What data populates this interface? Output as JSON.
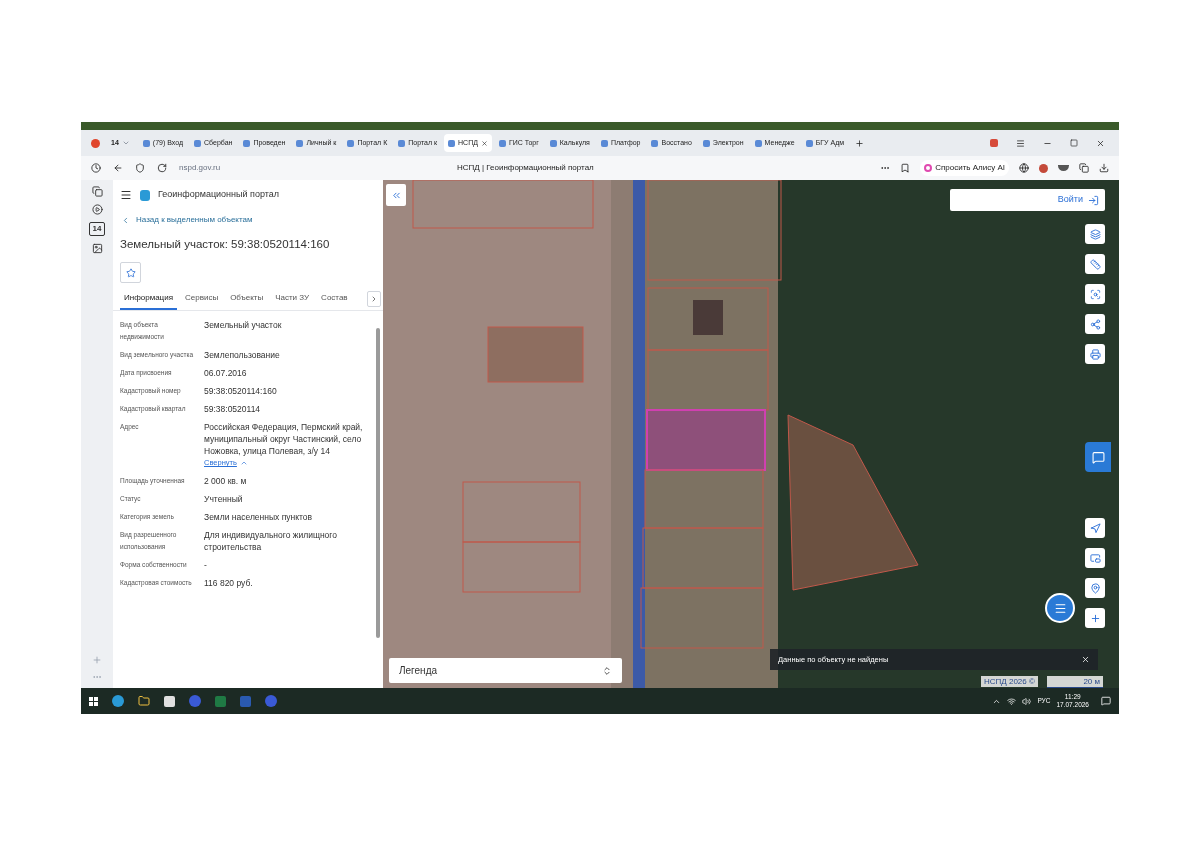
{
  "browser": {
    "tab_counter": "14",
    "tabs": [
      {
        "label": "(79) Вход",
        "selected": false
      },
      {
        "label": "Сбербан",
        "selected": false
      },
      {
        "label": "Проведен",
        "selected": false
      },
      {
        "label": "Личный к",
        "selected": false
      },
      {
        "label": "Портал К",
        "selected": false
      },
      {
        "label": "Портал к",
        "selected": false
      },
      {
        "label": "НСПД",
        "selected": true
      },
      {
        "label": "ГИС Торг",
        "selected": false
      },
      {
        "label": "Калькуля",
        "selected": false
      },
      {
        "label": "Платфор",
        "selected": false
      },
      {
        "label": "Восстано",
        "selected": false
      },
      {
        "label": "Электрон",
        "selected": false
      },
      {
        "label": "Менедже",
        "selected": false
      },
      {
        "label": "БГУ Адм",
        "selected": false
      }
    ],
    "address": "nspd.gov.ru",
    "page_title": "НСПД | Геоинформационный портал",
    "alice_button": "Спросить Алису AI",
    "sidebar_badge": "14"
  },
  "portal": {
    "title": "Геоинформационный портал",
    "back_link": "Назад к выделенным объектам",
    "heading": "Земельный участок: 59:38:0520114:160",
    "tabs": [
      {
        "label": "Информация",
        "selected": true
      },
      {
        "label": "Сервисы",
        "selected": false
      },
      {
        "label": "Объекты",
        "selected": false
      },
      {
        "label": "Части ЗУ",
        "selected": false
      },
      {
        "label": "Состав",
        "selected": false
      }
    ],
    "fields": [
      {
        "label": "Вид объекта недвижимости",
        "value": "Земельный участок"
      },
      {
        "label": "Вид земельного участка",
        "value": "Землепользование"
      },
      {
        "label": "Дата присвоения",
        "value": "06.07.2016"
      },
      {
        "label": "Кадастровый номер",
        "value": "59:38:0520114:160"
      },
      {
        "label": "Кадастровый квартал",
        "value": "59:38:0520114"
      },
      {
        "label": "Адрес",
        "value": "Российская Федерация, Пермский край, муниципальный округ Частинский, село Ножовка, улица Полевая, з/у 14",
        "link": "Свернуть"
      },
      {
        "label": "Площадь уточненная",
        "value": "2 000 кв. м"
      },
      {
        "label": "Статус",
        "value": "Учтенный"
      },
      {
        "label": "Категория земель",
        "value": "Земли населенных пунктов"
      },
      {
        "label": "Вид разрешенного использования",
        "value": "Для индивидуального жилищного строительства"
      },
      {
        "label": "Форма собственности",
        "value": "-"
      },
      {
        "label": "Кадастровая стоимость",
        "value": "116 820 руб."
      }
    ]
  },
  "map": {
    "login_button": "Войти",
    "legend": "Легенда",
    "toast": "Данные по объекту не найдены",
    "attribution": "НСПД 2026 ©",
    "scale": "20 м"
  },
  "taskbar": {
    "language": "РУС",
    "time": "11:29",
    "date": "17.07.2026"
  }
}
